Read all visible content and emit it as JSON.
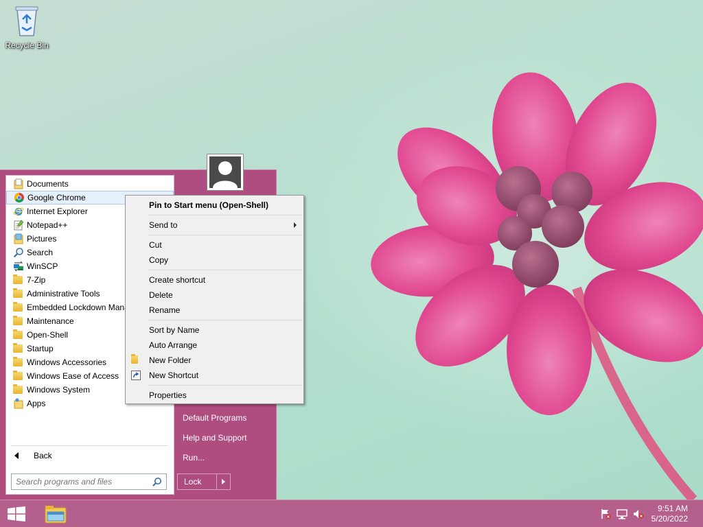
{
  "desktop": {
    "recycle_bin_label": "Recycle Bin"
  },
  "start_menu": {
    "programs": [
      {
        "label": "Documents",
        "icon": "documents-icon",
        "highlighted": false
      },
      {
        "label": "Google Chrome",
        "icon": "chrome-icon",
        "highlighted": true
      },
      {
        "label": "Internet Explorer",
        "icon": "internet-explorer-icon",
        "highlighted": false
      },
      {
        "label": "Notepad++",
        "icon": "notepad-plus-plus-icon",
        "highlighted": false
      },
      {
        "label": "Pictures",
        "icon": "pictures-icon",
        "highlighted": false
      },
      {
        "label": "Search",
        "icon": "search-icon",
        "highlighted": false
      },
      {
        "label": "WinSCP",
        "icon": "winscp-icon",
        "highlighted": false
      },
      {
        "label": "7-Zip",
        "icon": "folder-icon",
        "highlighted": false
      },
      {
        "label": "Administrative Tools",
        "icon": "folder-icon",
        "highlighted": false
      },
      {
        "label": "Embedded Lockdown Manager",
        "icon": "folder-icon",
        "highlighted": false
      },
      {
        "label": "Maintenance",
        "icon": "folder-icon",
        "highlighted": false
      },
      {
        "label": "Open-Shell",
        "icon": "folder-icon",
        "highlighted": false
      },
      {
        "label": "Startup",
        "icon": "folder-icon",
        "highlighted": false
      },
      {
        "label": "Windows Accessories",
        "icon": "folder-icon",
        "highlighted": false
      },
      {
        "label": "Windows Ease of Access",
        "icon": "folder-icon",
        "highlighted": false
      },
      {
        "label": "Windows System",
        "icon": "folder-icon",
        "highlighted": false
      },
      {
        "label": "Apps",
        "icon": "apps-icon",
        "highlighted": false
      }
    ],
    "back_label": "Back",
    "search_placeholder": "Search programs and files",
    "right_links": {
      "default_programs": "Default Programs",
      "help_and_support": "Help and Support",
      "run": "Run..."
    },
    "lock_label": "Lock"
  },
  "context_menu": {
    "pin": "Pin to Start menu (Open-Shell)",
    "send_to": "Send to",
    "cut": "Cut",
    "copy": "Copy",
    "create_shortcut": "Create shortcut",
    "delete": "Delete",
    "rename": "Rename",
    "sort_by_name": "Sort by Name",
    "auto_arrange": "Auto Arrange",
    "new_folder": "New Folder",
    "new_shortcut": "New Shortcut",
    "properties": "Properties"
  },
  "taskbar": {
    "time": "9:51 AM",
    "date": "5/20/2022"
  },
  "colors": {
    "accent": "#b04d80",
    "taskbar": "#b45f8c",
    "highlight": "#e5f0fb"
  }
}
